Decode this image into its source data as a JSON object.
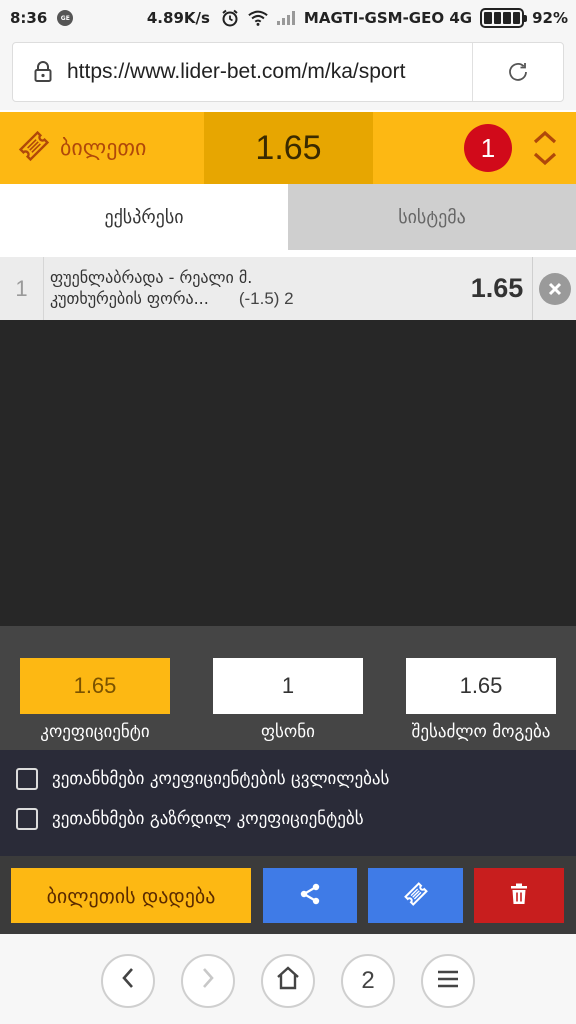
{
  "status_bar": {
    "time": "8:36",
    "notification_badge": "GE SK",
    "speed": "4.89K/s",
    "carrier": "MAGTI-GSM-GEO 4G",
    "battery": "92%"
  },
  "browser": {
    "url": "https://www.lider-bet.com/m/ka/sport",
    "tabs_count": "2"
  },
  "betslip": {
    "title": "ბილეთი",
    "total_odds": "1.65",
    "selections_count": "1",
    "tabs": [
      {
        "label": "ექსპრესი",
        "active": true
      },
      {
        "label": "სისტემა",
        "active": false
      }
    ],
    "bets": [
      {
        "index": "1",
        "match": "ფუენლაბრადა - რეალი მ.",
        "market": "კუთხურების ფორა...",
        "spec": "(-1.5) 2",
        "odds": "1.65"
      }
    ],
    "summary": {
      "coefficient_value": "1.65",
      "coefficient_label": "კოეფიციენტი",
      "stake_value": "1",
      "stake_label": "ფსონი",
      "win_value": "1.65",
      "win_label": "შესაძლო მოგება"
    },
    "agreements": [
      {
        "label": "ვეთანხმები კოეფიციენტების ცვლილებას",
        "checked": false
      },
      {
        "label": "ვეთანხმები გაზრდილ კოეფიციენტებს",
        "checked": false
      }
    ],
    "place_button": "ბილეთის დადება"
  },
  "colors": {
    "accent": "#fdb813",
    "accent_dark": "#e7a601",
    "badge_red": "#d10a1a",
    "button_blue": "#3f7be7",
    "delete_red": "#c81e1e"
  },
  "icons": {
    "lock": "lock-icon",
    "reload": "reload-icon",
    "ticket": "ticket-icon",
    "updown": "chevron-updown-icon",
    "remove": "close-icon",
    "share": "share-icon",
    "trash": "trash-icon",
    "back": "chevron-left-icon",
    "forward": "chevron-right-icon",
    "home": "home-icon",
    "menu": "menu-icon"
  }
}
